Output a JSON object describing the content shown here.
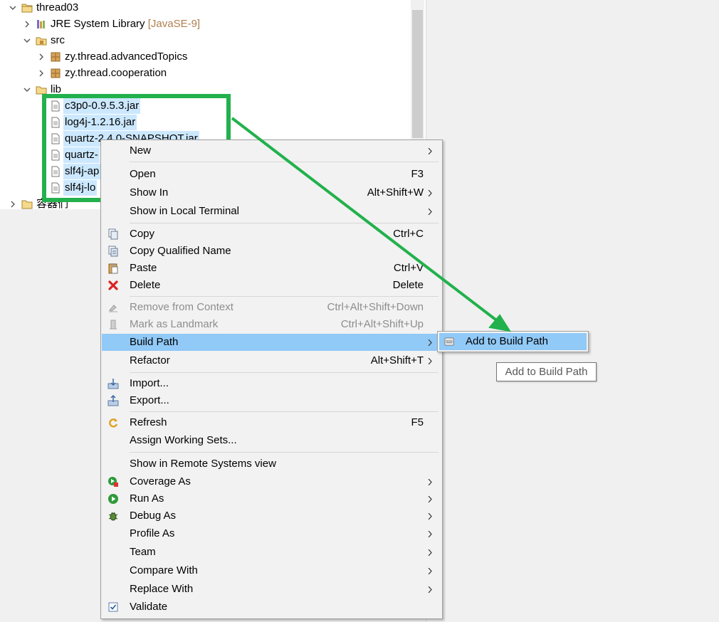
{
  "tree": {
    "project": "thread03",
    "jre_label": "JRE System Library",
    "jre_decoration": "[JavaSE-9]",
    "src": "src",
    "packages": [
      "zy.thread.advancedTopics",
      "zy.thread.cooperation"
    ],
    "lib": "lib",
    "jars": [
      "c3p0-0.9.5.3.jar",
      "log4j-1.2.16.jar",
      "quartz-2.4.0-SNAPSHOT.jar",
      "quartz-",
      "slf4j-ap",
      "slf4j-lo"
    ],
    "next_project": "容器们"
  },
  "menu": {
    "new": "New",
    "open": "Open",
    "open_sc": "F3",
    "show_in": "Show In",
    "show_in_sc": "Alt+Shift+W",
    "show_local_terminal": "Show in Local Terminal",
    "copy": "Copy",
    "copy_sc": "Ctrl+C",
    "copy_qualified": "Copy Qualified Name",
    "paste": "Paste",
    "paste_sc": "Ctrl+V",
    "delete": "Delete",
    "delete_sc": "Delete",
    "remove_context": "Remove from Context",
    "remove_context_sc": "Ctrl+Alt+Shift+Down",
    "mark_landmark": "Mark as Landmark",
    "mark_landmark_sc": "Ctrl+Alt+Shift+Up",
    "build_path": "Build Path",
    "refactor": "Refactor",
    "refactor_sc": "Alt+Shift+T",
    "import": "Import...",
    "export": "Export...",
    "refresh": "Refresh",
    "refresh_sc": "F5",
    "assign_ws": "Assign Working Sets...",
    "show_remote": "Show in Remote Systems view",
    "coverage_as": "Coverage As",
    "run_as": "Run As",
    "debug_as": "Debug As",
    "profile_as": "Profile As",
    "team": "Team",
    "compare_with": "Compare With",
    "replace_with": "Replace With",
    "validate": "Validate"
  },
  "submenu": {
    "add_to_build_path": "Add to Build Path"
  },
  "tooltip": {
    "text": "Add to Build Path"
  },
  "colors": {
    "highlight": "#91c9f7",
    "annotation": "#22b14c",
    "selection": "#cce8ff"
  }
}
